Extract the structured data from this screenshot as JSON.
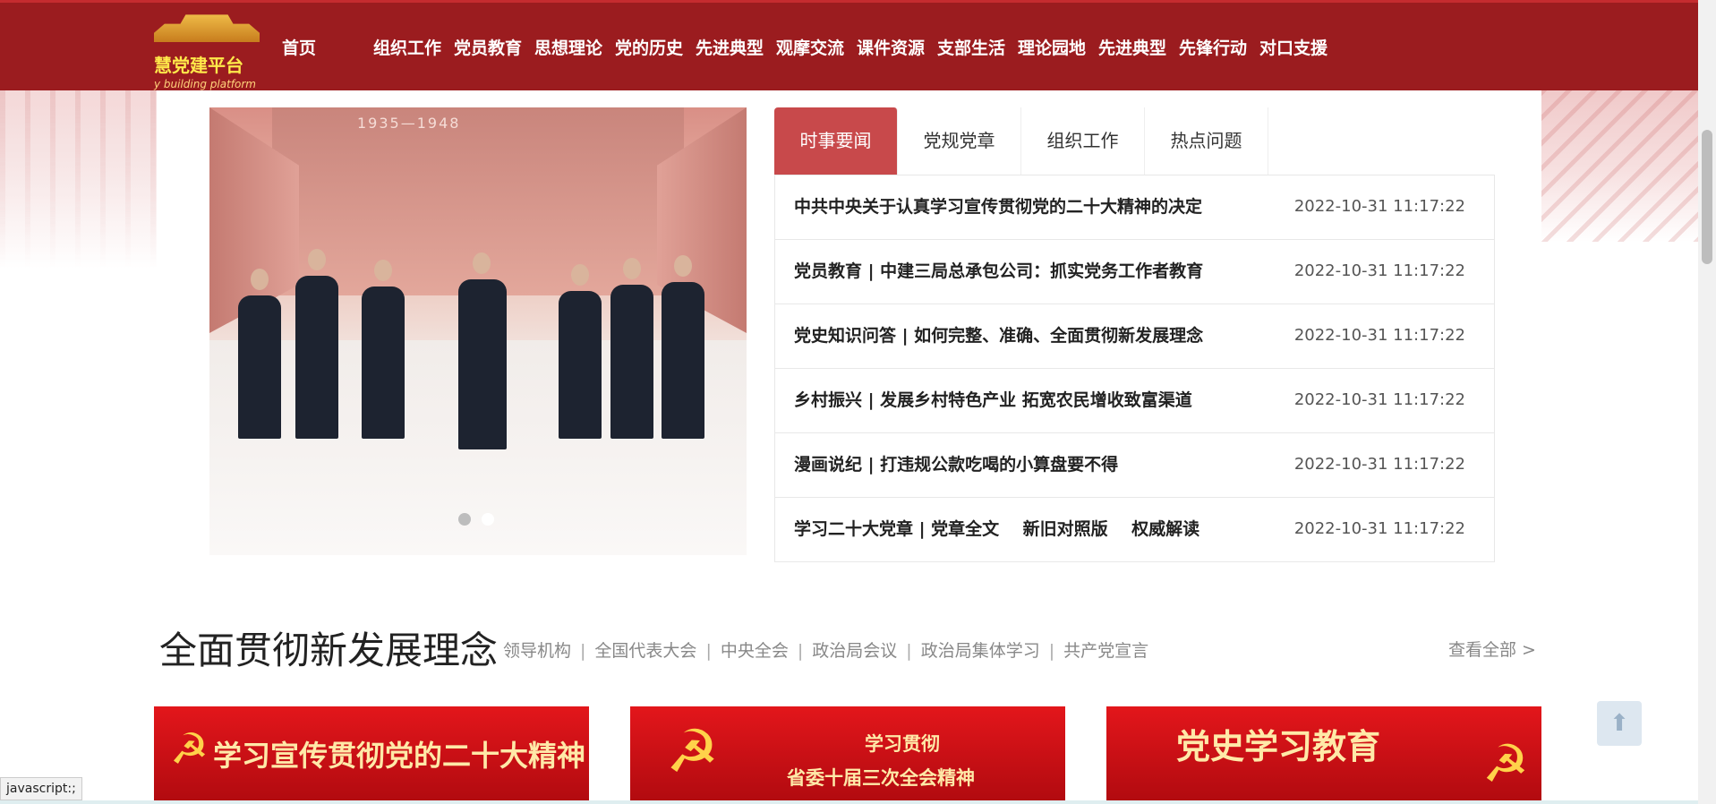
{
  "logo": {
    "title": "慧党建平台",
    "subtitle": "y building platform"
  },
  "nav": [
    {
      "label": "首页"
    },
    {
      "label": "组织工作"
    },
    {
      "label": "党员教育"
    },
    {
      "label": "思想理论"
    },
    {
      "label": "党的历史"
    },
    {
      "label": "先进典型"
    },
    {
      "label": "观摩交流"
    },
    {
      "label": "课件资源"
    },
    {
      "label": "支部生活"
    },
    {
      "label": "理论园地"
    },
    {
      "label": "先进典型"
    },
    {
      "label": "先锋行动"
    },
    {
      "label": "对口支援"
    }
  ],
  "slider": {
    "caption_year": "1935—1948",
    "dots": 2,
    "active_dot": 1
  },
  "tabs": [
    {
      "label": "时事要闻",
      "active": true
    },
    {
      "label": "党规党章",
      "active": false
    },
    {
      "label": "组织工作",
      "active": false
    },
    {
      "label": "热点问题",
      "active": false
    }
  ],
  "news": [
    {
      "title": "中共中央关于认真学习宣传贯彻党的二十大精神的决定",
      "date": "2022-10-31 11:17:22"
    },
    {
      "title": "党员教育 | 中建三局总承包公司：抓实党务工作者教育",
      "date": "2022-10-31 11:17:22"
    },
    {
      "title": "党史知识问答 | 如何完整、准确、全面贯彻新发展理念",
      "date": "2022-10-31 11:17:22"
    },
    {
      "title": "乡村振兴 | 发展乡村特色产业 拓宽农民增收致富渠道",
      "date": "2022-10-31 11:17:22"
    },
    {
      "title": "漫画说纪 | 打违规公款吃喝的小算盘要不得",
      "date": "2022-10-31 11:17:22"
    },
    {
      "title": "学习二十大党章 | 党章全文    新旧对照版    权威解读",
      "date": "2022-10-31 11:17:22"
    }
  ],
  "section": {
    "title": "全面贯彻新发展理念",
    "links": [
      "领导机构",
      "全国代表大会",
      "中央全会",
      "政治局会议",
      "政治局集体学习",
      "共产党宣言"
    ],
    "view_all": "查看全部 >"
  },
  "banners": [
    {
      "text": "学习宣传贯彻党的二十大精神"
    },
    {
      "line1": "学习贯彻",
      "line2": "省委十届三次全会精神"
    },
    {
      "text": "党史学习教育"
    }
  ],
  "status_bar": "javascript:;",
  "colors": {
    "header": "#9b1c1f",
    "tab_active": "#c8494b",
    "banner": "#d0121a"
  }
}
